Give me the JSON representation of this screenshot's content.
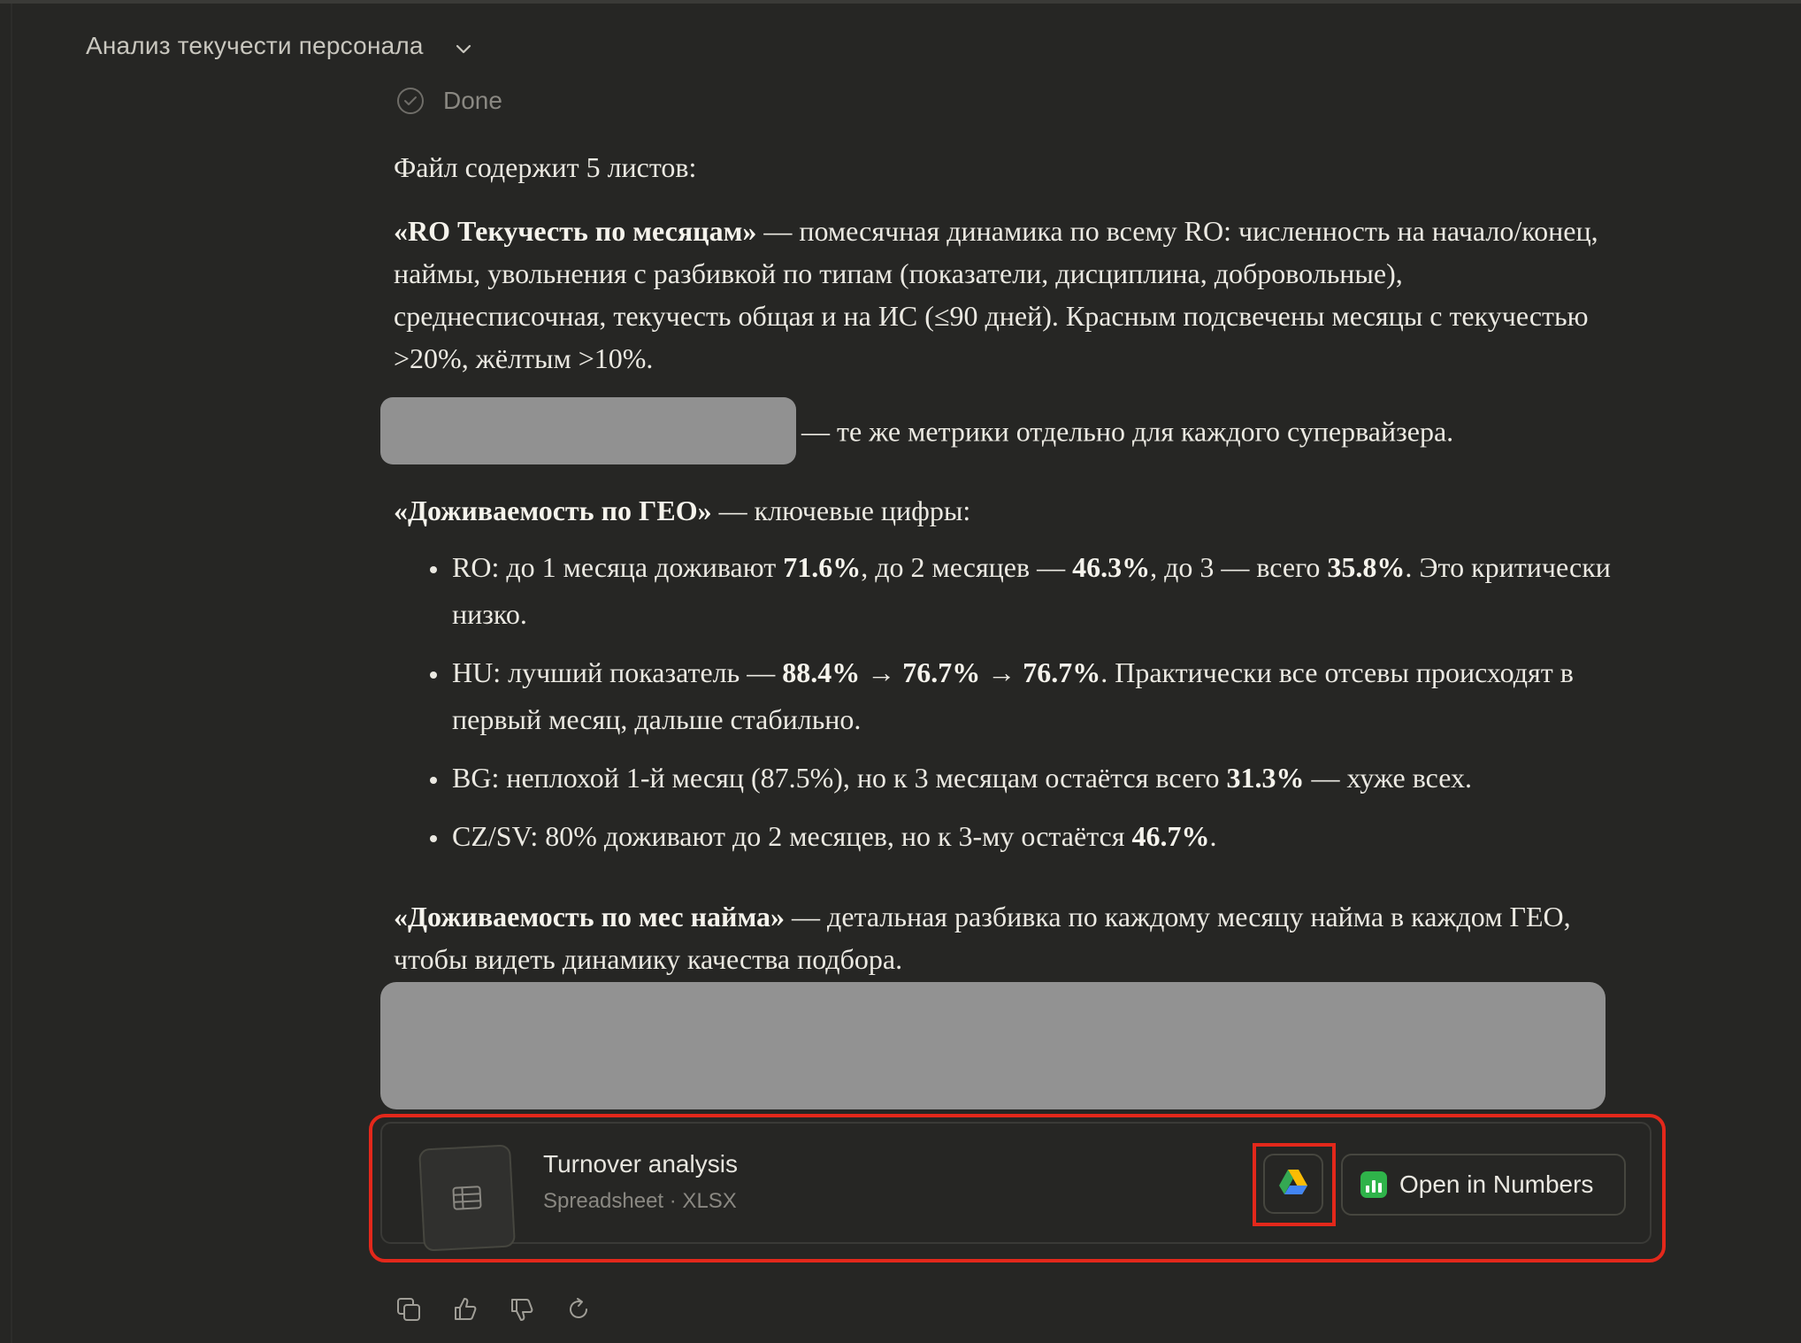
{
  "header": {
    "title": "Анализ текучести персонала"
  },
  "status": {
    "done_label": "Done"
  },
  "message": {
    "intro": "Файл содержит 5 листов:",
    "p1_bold": "«RO Текучесть по месяцам»",
    "p1_rest": " — помесячная динамика по всему RO: численность на начало/конец, наймы, увольнения с разбивкой по типам (показатели, дисциплина, добровольные), среднесписочная, текучесть общая и на ИС (≤90 дней). Красным подсвечены месяцы с текучестью >20%, жёлтым >10%.",
    "p2_rest": "— те же метрики отдельно для каждого супервайзера.",
    "p3_bold": "«Доживаемость по ГЕО»",
    "p3_rest": " — ключевые цифры:",
    "bullets": {
      "b1": {
        "t1": "RO: до 1 месяца доживают ",
        "v1": "71.6%",
        "t2": ", до 2 месяцев — ",
        "v2": "46.3%",
        "t3": ", до 3 — всего ",
        "v3": "35.8%",
        "t4": ". Это критически низко."
      },
      "b2": {
        "t1": "HU: лучший показатель — ",
        "v1": "88.4%",
        "t2": " → ",
        "v2": "76.7%",
        "t3": " → ",
        "v3": "76.7%",
        "t4": ". Практически все отсевы происходят в первый месяц, дальше стабильно."
      },
      "b3": {
        "t1": "BG: неплохой 1-й месяц (87.5%), но к 3 месяцам остаётся всего ",
        "v1": "31.3%",
        "t2": " — хуже всех."
      },
      "b4": {
        "t1": "CZ/SV: 80% доживают до 2 месяцев, но к 3-му остаётся ",
        "v1": "46.7%",
        "t2": "."
      }
    },
    "p4_bold": "«Доживаемость по мес найма»",
    "p4_rest": " — детальная разбивка по каждому месяцу найма в каждом ГЕО, чтобы видеть динамику качества подбора."
  },
  "file_card": {
    "name": "Turnover analysis",
    "meta": "Spreadsheet · XLSX",
    "drive_icon": "google-drive-icon",
    "open_label": "Open in Numbers",
    "numbers_icon": "numbers-app-icon",
    "highlight_color": "#e3281b"
  },
  "actions": [
    "copy-icon",
    "thumbs-up-icon",
    "thumbs-down-icon",
    "retry-icon"
  ]
}
